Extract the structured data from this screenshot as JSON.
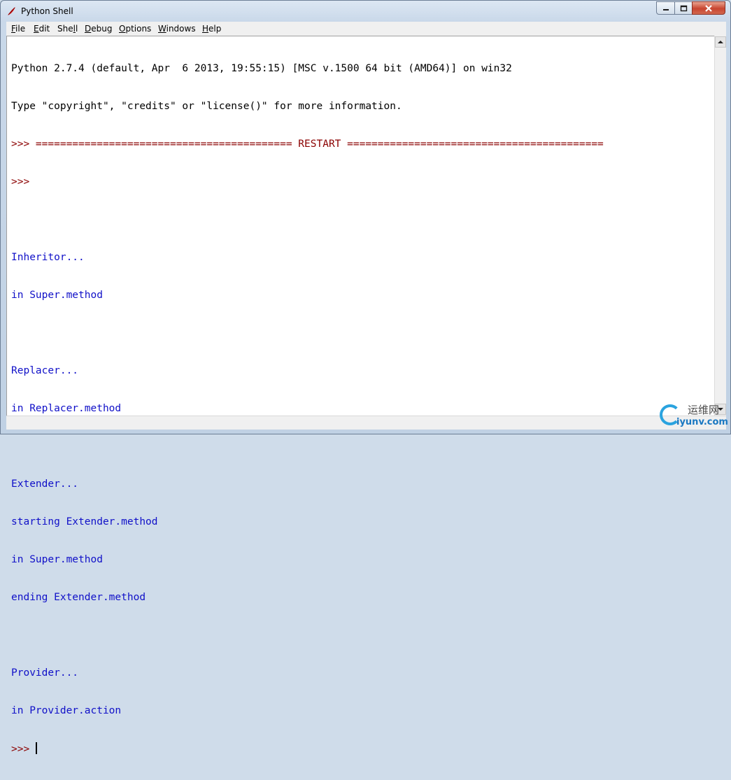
{
  "window": {
    "title": "Python Shell"
  },
  "menubar": {
    "items": [
      {
        "underline": "F",
        "rest": "ile"
      },
      {
        "underline": "E",
        "rest": "dit"
      },
      {
        "pre": "She",
        "underline": "l",
        "rest": "l"
      },
      {
        "underline": "D",
        "rest": "ebug"
      },
      {
        "underline": "O",
        "rest": "ptions"
      },
      {
        "underline": "W",
        "rest": "indows"
      },
      {
        "underline": "H",
        "rest": "elp"
      }
    ]
  },
  "shell": {
    "banner_line1": "Python 2.7.4 (default, Apr  6 2013, 19:55:15) [MSC v.1500 64 bit (AMD64)] on win32",
    "banner_line2": "Type \"copyright\", \"credits\" or \"license()\" for more information.",
    "restart_line": ">>> ========================================== RESTART ==========================================",
    "prompt": ">>>",
    "output": [
      "Inheritor...",
      "in Super.method",
      "",
      "Replacer...",
      "in Replacer.method",
      "",
      "Extender...",
      "starting Extender.method",
      "in Super.method",
      "ending Extender.method",
      "",
      "Provider...",
      "in Provider.action"
    ]
  },
  "watermark": {
    "cn": "运维网",
    "en": "iyunv.com"
  },
  "icons": {
    "app": "tk-feather-icon",
    "minimize": "minimize-icon",
    "maximize": "maximize-icon",
    "close": "close-icon",
    "scroll_up": "arrow-up-icon",
    "scroll_down": "arrow-down-icon"
  },
  "colors": {
    "output": "#1010c8",
    "prompt": "#8b0000",
    "banner": "#000000"
  }
}
